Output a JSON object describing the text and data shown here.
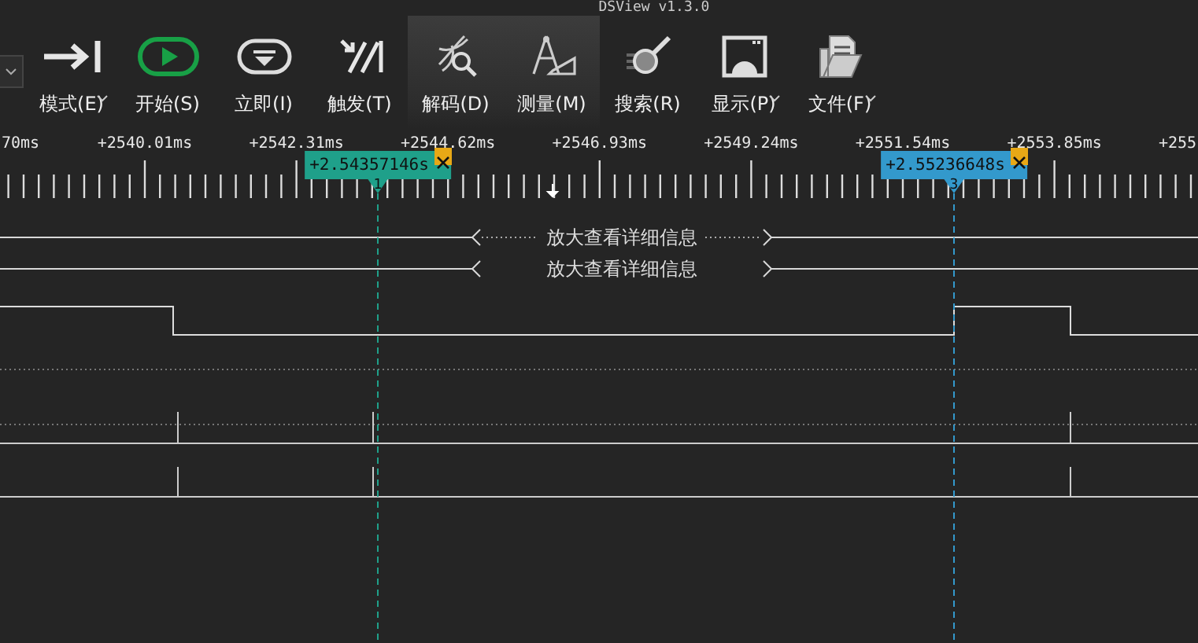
{
  "window": {
    "title": "DSView v1.3.0"
  },
  "toolbar": [
    {
      "label": "模式(E)",
      "kind": "mode",
      "dropdown": true,
      "highlighted": false
    },
    {
      "label": "开始(S)",
      "kind": "start",
      "dropdown": false,
      "highlighted": false
    },
    {
      "label": "立即(I)",
      "kind": "instant",
      "dropdown": false,
      "highlighted": false
    },
    {
      "label": "触发(T)",
      "kind": "trigger",
      "dropdown": false,
      "highlighted": false
    },
    {
      "label": "解码(D)",
      "kind": "decode",
      "dropdown": false,
      "highlighted": true
    },
    {
      "label": "测量(M)",
      "kind": "measure",
      "dropdown": false,
      "highlighted": true
    },
    {
      "label": "搜索(R)",
      "kind": "search",
      "dropdown": false,
      "highlighted": false
    },
    {
      "label": "显示(P)",
      "kind": "display",
      "dropdown": true,
      "highlighted": false
    },
    {
      "label": "文件(F)",
      "kind": "file",
      "dropdown": true,
      "highlighted": false
    }
  ],
  "ruler": {
    "labels": [
      "70ms",
      "+2540.01ms",
      "+2542.31ms",
      "+2544.62ms",
      "+2546.93ms",
      "+2549.24ms",
      "+2551.54ms",
      "+2553.85ms",
      "+255"
    ]
  },
  "cursors": [
    {
      "label": "+2.54357146s",
      "number": "1",
      "color": "#1fa08a"
    },
    {
      "label": "+2.55236648s",
      "number": "3",
      "color": "#3399cc"
    }
  ],
  "decode_rows": [
    {
      "text": "放大查看详细信息"
    },
    {
      "text": "放大查看详细信息"
    }
  ]
}
